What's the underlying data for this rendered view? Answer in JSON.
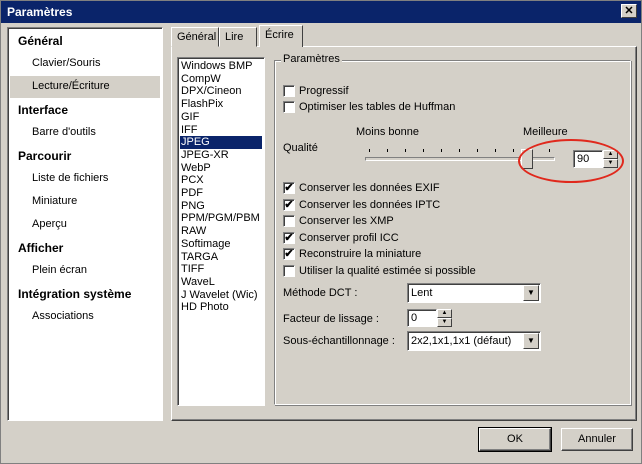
{
  "window": {
    "title": "Paramètres",
    "close_glyph": "✕"
  },
  "sidebar": {
    "sections": [
      {
        "label": "Général",
        "items": [
          "Clavier/Souris",
          "Lecture/Écriture"
        ]
      },
      {
        "label": "Interface",
        "items": [
          "Barre d'outils"
        ]
      },
      {
        "label": "Parcourir",
        "items": [
          "Liste de fichiers",
          "Miniature",
          "Aperçu"
        ]
      },
      {
        "label": "Afficher",
        "items": [
          "Plein écran"
        ]
      },
      {
        "label": "Intégration système",
        "items": [
          "Associations"
        ]
      }
    ],
    "selected": "Lecture/Écriture"
  },
  "tabs": {
    "items": [
      "Général",
      "Lire",
      "Écrire"
    ],
    "active": "Écrire"
  },
  "formats": {
    "items": [
      "Windows BMP",
      "CompW",
      "DPX/Cineon",
      "FlashPix",
      "GIF",
      "IFF",
      "JPEG",
      "JPEG-XR",
      "WebP",
      "PCX",
      "PDF",
      "PNG",
      "PPM/PGM/PBM",
      "RAW",
      "Softimage",
      "TARGA",
      "TIFF",
      "WaveL",
      "J Wavelet (Wic)",
      "HD Photo"
    ],
    "selected": "JPEG"
  },
  "params": {
    "group_label": "Paramètres",
    "progressive": {
      "label": "Progressif",
      "checked": false
    },
    "huffman": {
      "label": "Optimiser les tables de Huffman",
      "checked": false
    },
    "quality": {
      "label": "Qualité",
      "min_label": "Moins bonne",
      "max_label": "Meilleure",
      "value": "90",
      "slider_fraction": 0.9
    },
    "options": [
      {
        "label": "Conserver les données EXIF",
        "checked": true
      },
      {
        "label": "Conserver les données IPTC",
        "checked": true
      },
      {
        "label": "Conserver les XMP",
        "checked": false
      },
      {
        "label": "Conserver profil ICC",
        "checked": true
      },
      {
        "label": "Reconstruire la miniature",
        "checked": true
      },
      {
        "label": "Utiliser la qualité estimée si possible",
        "checked": false
      }
    ],
    "dct": {
      "label": "Méthode DCT :",
      "value": "Lent"
    },
    "smoothing": {
      "label": "Facteur de lissage :",
      "value": "0"
    },
    "subsampling": {
      "label": "Sous-échantillonnage :",
      "value": "2x2,1x1,1x1 (défaut)"
    }
  },
  "buttons": {
    "ok": "OK",
    "cancel": "Annuler"
  },
  "check_glyph": "✔",
  "colors": {
    "titlebar": "#0a246a",
    "selection": "#0a246a",
    "annotation": "#e0281c"
  }
}
